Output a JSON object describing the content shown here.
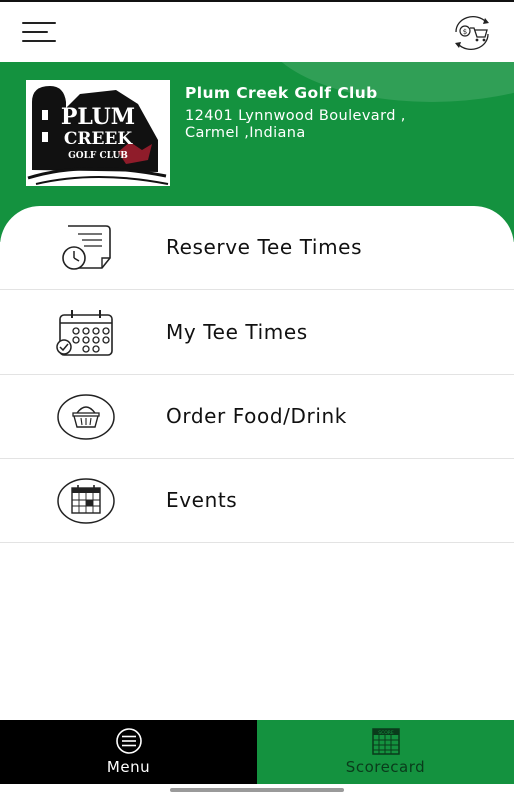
{
  "club": {
    "name": "Plum Creek Golf Club",
    "address_line1": "12401 Lynnwood Boulevard ,",
    "address_line2": "Carmel ,Indiana",
    "logo": {
      "line1": "PLUM",
      "line2": "CREEK",
      "line3": "GOLF CLUB"
    }
  },
  "toolbar": {
    "menu_icon": "hamburger-icon",
    "cart_icon": "dollar-cart-icon"
  },
  "menu": {
    "items": [
      {
        "label": "Reserve Tee Times",
        "icon": "clock-document-icon"
      },
      {
        "label": "My Tee Times",
        "icon": "calendar-check-icon"
      },
      {
        "label": "Order Food/Drink",
        "icon": "basket-icon"
      },
      {
        "label": "Events",
        "icon": "calendar-icon"
      }
    ]
  },
  "bottom_nav": {
    "menu_label": "Menu",
    "scorecard_label": "Scorecard",
    "scorecard_icon_text": "SCORE"
  },
  "colors": {
    "brand_green": "#14923f",
    "nav_black": "#000000"
  }
}
